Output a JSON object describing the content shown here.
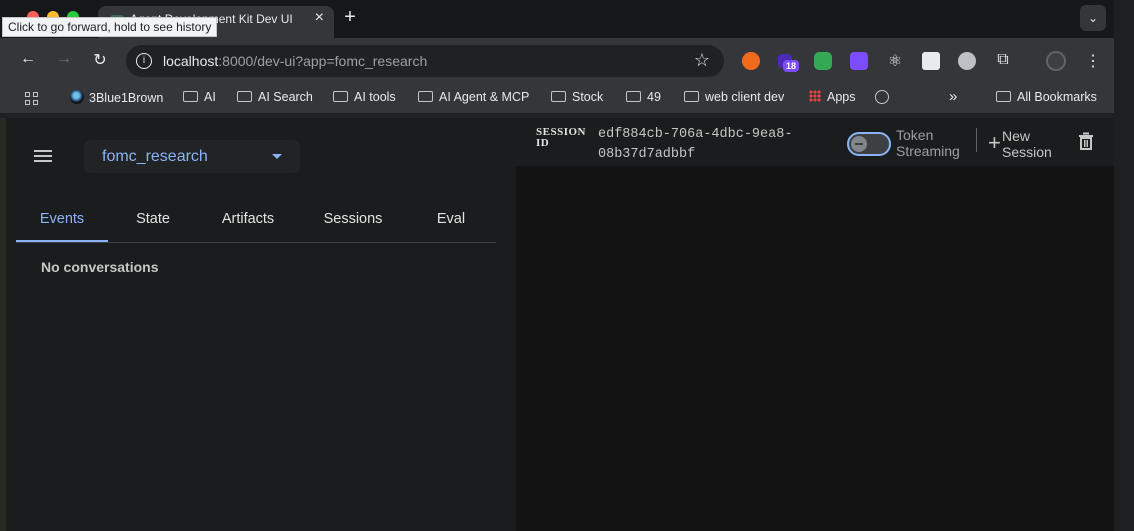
{
  "browser": {
    "tab_title": "Agent Development Kit Dev UI",
    "tooltip": "Click to go forward, hold to see history",
    "new_tab_label": "+",
    "url_host": "localhost",
    "url_rest": ":8000/dev-ui?app=fomc_research",
    "extension_badge": "18",
    "bookmarks": [
      {
        "label": "3Blue1Brown"
      },
      {
        "label": "AI"
      },
      {
        "label": "AI Search"
      },
      {
        "label": "AI tools"
      },
      {
        "label": "AI Agent & MCP"
      },
      {
        "label": "Stock"
      },
      {
        "label": "49"
      },
      {
        "label": "web client dev"
      },
      {
        "label": "Apps"
      }
    ],
    "overflow_label": "»",
    "all_bookmarks_label": "All Bookmarks"
  },
  "sidebar": {
    "app_name": "fomc_research",
    "tabs": [
      {
        "label": "Events"
      },
      {
        "label": "State"
      },
      {
        "label": "Artifacts"
      },
      {
        "label": "Sessions"
      },
      {
        "label": "Eval"
      }
    ],
    "active_tab": "Events",
    "empty_message": "No conversations"
  },
  "header": {
    "session_label": "SESSION ID",
    "session_id": "edf884cb-706a-4dbc-9ea8-08b37d7adbbf",
    "token_streaming_label": "Token Streaming",
    "token_streaming_enabled": false,
    "new_session_label": "New Session"
  },
  "colors": {
    "accent": "#8ab4f8",
    "sidebar_bg": "#1b1c1d",
    "main_bg": "#131314"
  }
}
